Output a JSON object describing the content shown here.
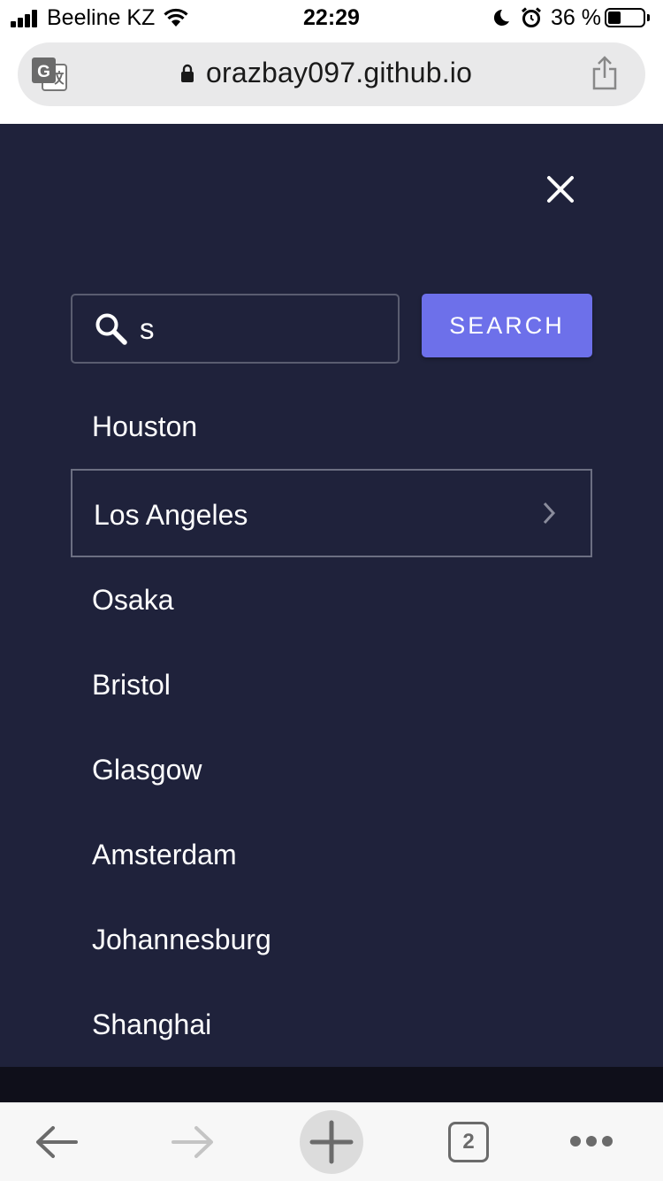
{
  "status_bar": {
    "carrier": "Beeline KZ",
    "time": "22:29",
    "battery_percent": "36 %",
    "battery_level": 0.36
  },
  "address_bar": {
    "url": "orazbay097.github.io",
    "icons": [
      "translate-icon",
      "lock-icon",
      "share-icon"
    ]
  },
  "search": {
    "input_value": "s",
    "button_label": "SEARCH"
  },
  "cities": [
    {
      "label": "Houston",
      "selected": false
    },
    {
      "label": "Los Angeles",
      "selected": true
    },
    {
      "label": "Osaka",
      "selected": false
    },
    {
      "label": "Bristol",
      "selected": false
    },
    {
      "label": "Glasgow",
      "selected": false
    },
    {
      "label": "Amsterdam",
      "selected": false
    },
    {
      "label": "Johannesburg",
      "selected": false
    },
    {
      "label": "Shanghai",
      "selected": false
    }
  ],
  "toolbar": {
    "tab_count": "2",
    "icons": [
      "back-arrow-icon",
      "forward-arrow-icon",
      "plus-icon",
      "tabs-icon",
      "more-icon"
    ]
  },
  "colors": {
    "overlay_bg": "#1f223b",
    "accent": "#6d70ea",
    "text": "#ffffff"
  }
}
